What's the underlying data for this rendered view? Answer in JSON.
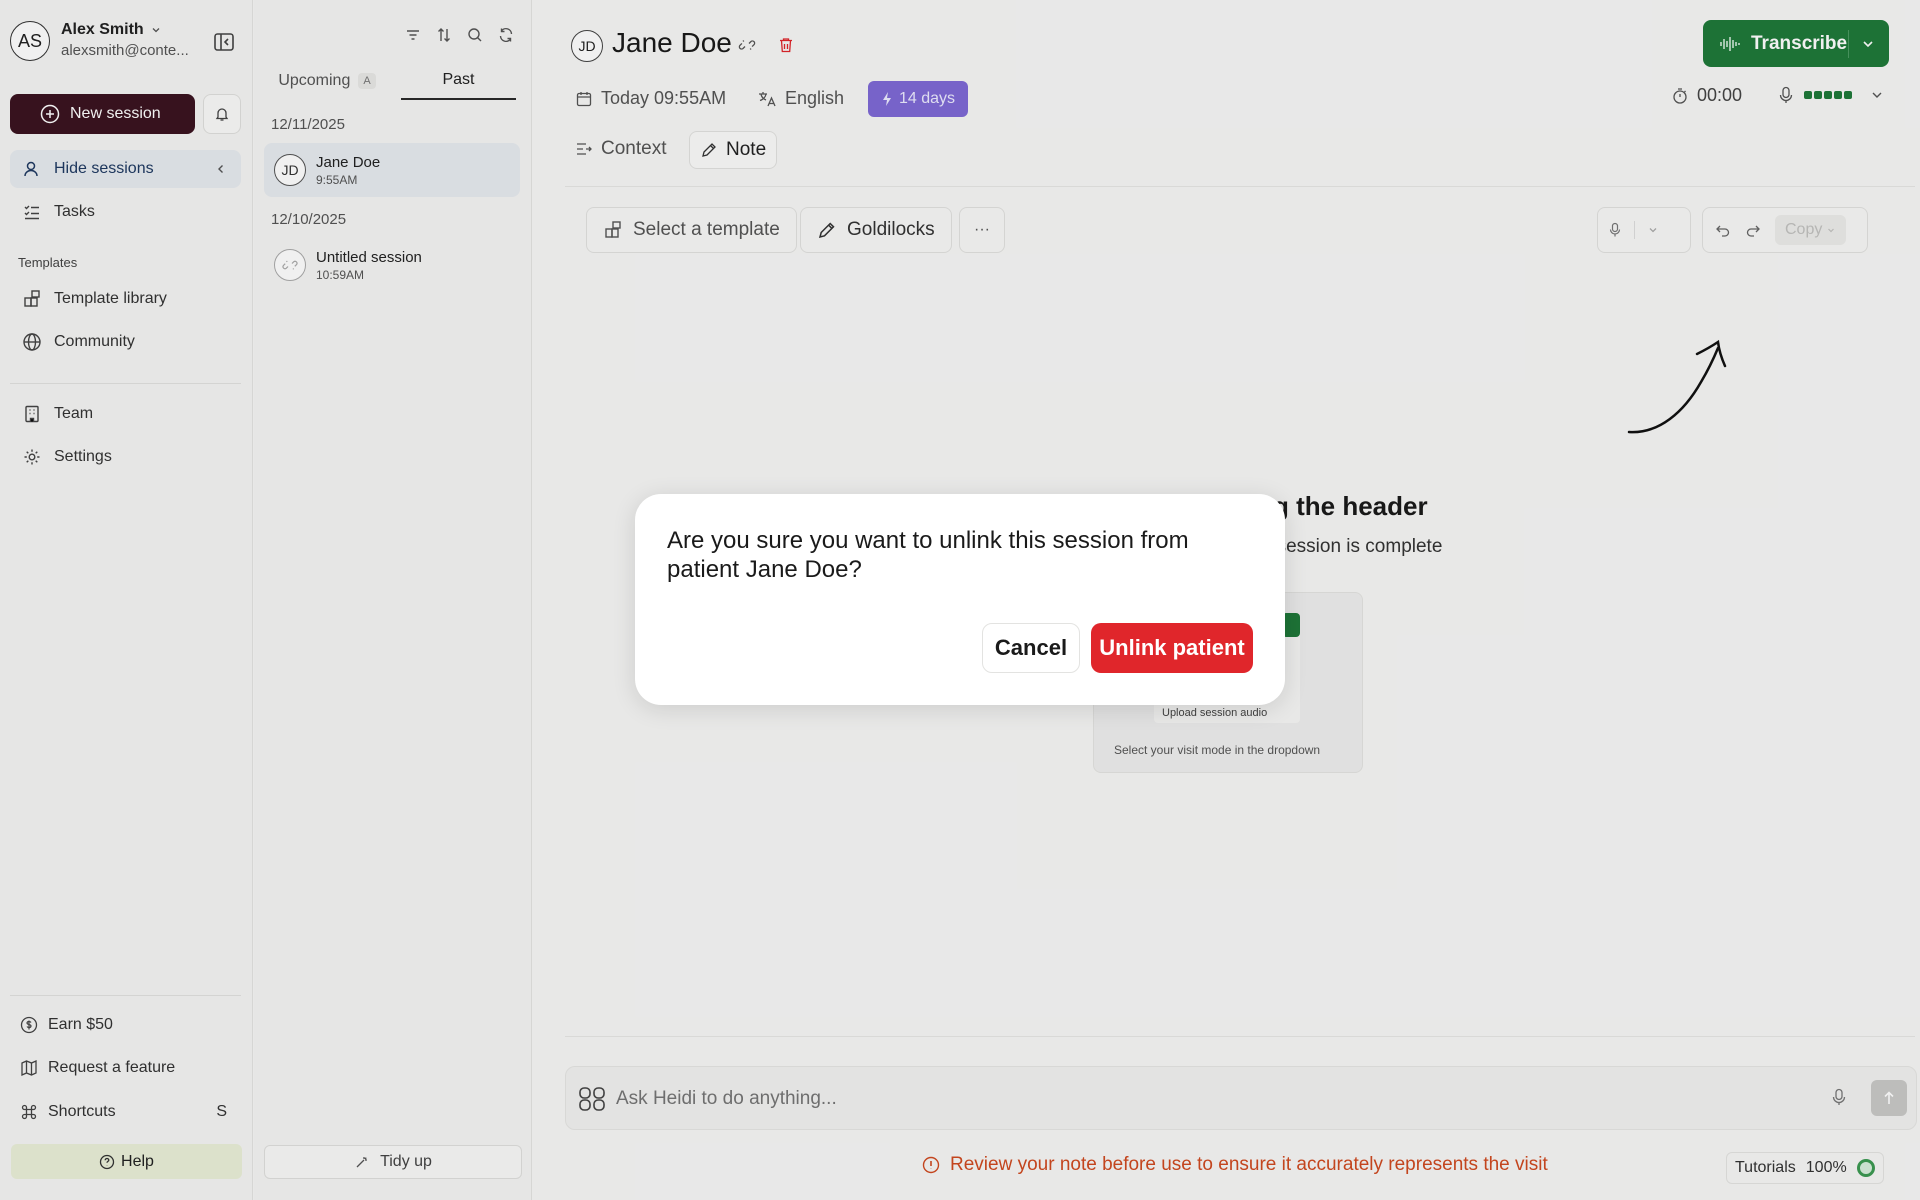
{
  "user": {
    "initials": "AS",
    "name": "Alex Smith",
    "email": "alexsmith@conte..."
  },
  "sidebar": {
    "new_session": "New session",
    "hide_sessions": "Hide sessions",
    "tasks": "Tasks",
    "templates_heading": "Templates",
    "template_library": "Template library",
    "community": "Community",
    "team": "Team",
    "settings": "Settings",
    "earn": "Earn $50",
    "request_feature": "Request a feature",
    "shortcuts": "Shortcuts",
    "shortcuts_key": "S",
    "help": "Help"
  },
  "sessions": {
    "tabs": {
      "upcoming": "Upcoming",
      "upcoming_badge": "A",
      "past": "Past"
    },
    "groups": [
      {
        "date": "12/11/2025",
        "items": [
          {
            "initials": "JD",
            "name": "Jane Doe",
            "time": "9:55AM"
          }
        ]
      },
      {
        "date": "12/10/2025",
        "items": [
          {
            "name": "Untitled session",
            "time": "10:59AM"
          }
        ]
      }
    ],
    "tidy_up": "Tidy up"
  },
  "header": {
    "initials": "JD",
    "patient_name": "Jane Doe",
    "date": "Today 09:55AM",
    "language": "English",
    "retention": "14 days",
    "timer": "00:00",
    "transcribe": "Transcribe",
    "tabs": {
      "context": "Context",
      "note": "Note"
    }
  },
  "toolbar": {
    "select_template": "Select a template",
    "goldilocks": "Goldilocks",
    "more": "···",
    "copy": "Copy"
  },
  "content": {
    "heading_partial": "g the header",
    "sub_partial": "r session is complete",
    "upload": "Upload session audio",
    "visit_mode": "Select your visit mode in the dropdown"
  },
  "ask": {
    "placeholder": "Ask Heidi to do anything..."
  },
  "footer": {
    "warning": "Review your note before use to ensure it accurately represents the visit",
    "tutorials": "Tutorials",
    "zoom": "100%"
  },
  "modal": {
    "message": "Are you sure you want to unlink this session from patient Jane Doe?",
    "cancel": "Cancel",
    "confirm": "Unlink patient"
  },
  "colors": {
    "brand": "#3b1420",
    "transcribe": "#1f7a3a",
    "danger": "#e0262b",
    "retention": "#7f6ad6",
    "warning": "#d04a20",
    "active_nav": "#e7ebf0"
  }
}
